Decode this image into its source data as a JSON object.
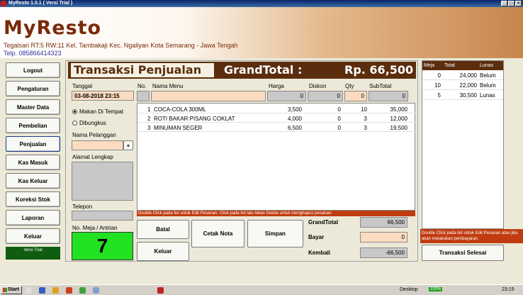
{
  "window": {
    "title": "MyResto 1.0.1 ( Versi Trial )"
  },
  "header": {
    "logo": "MyResto",
    "address": "Tegalsari RT:5 RW:11 Kel. Tambakaji Kec. Ngaliyan Kota Semarang - Jawa Tengah",
    "phone": "Telp. 085866414323"
  },
  "sidebar": {
    "items": [
      {
        "label": "Logout"
      },
      {
        "label": "Pengaturan"
      },
      {
        "label": "Master Data"
      },
      {
        "label": "Pembelian"
      },
      {
        "label": "Penjualan"
      },
      {
        "label": "Kas Masuk"
      },
      {
        "label": "Kas Keluar"
      },
      {
        "label": "Koreksi Stok"
      },
      {
        "label": "Laporan"
      },
      {
        "label": "Keluar"
      }
    ],
    "version": "Versi Trial"
  },
  "main": {
    "title": "Transaksi Penjualan",
    "grandtotal_label": "GrandTotal :",
    "grandtotal_value": "Rp. 66,500",
    "tanggal_label": "Tanggal",
    "tanggal_value": "03-08-2018 23:15",
    "radio_makan": "Makan Di Tempat",
    "radio_bungkus": "Dibungkus",
    "nama_pelanggan_label": "Nama Pelanggan",
    "plus": "+",
    "alamat_label": "Alamat Lengkap",
    "telepon_label": "Telepon",
    "meja_label": "No. Meja / Antrian",
    "meja_value": "7",
    "col_no": "No.",
    "col_nama": "Nama Menu",
    "col_harga": "Harga",
    "col_diskon": "Diskon",
    "col_qty": "Qty",
    "col_subtotal": "SubTotal",
    "input_harga": "0",
    "input_diskon": "0",
    "input_qty": "0",
    "input_subtotal": "0",
    "rows": [
      {
        "no": "1",
        "nama": "COCA-COLA 300ML",
        "harga": "3,500",
        "diskon": "0",
        "qty": "10",
        "subtotal": "35,000"
      },
      {
        "no": "2",
        "nama": "ROTI BAKAR PISANG COKLAT",
        "harga": "4,000",
        "diskon": "0",
        "qty": "3",
        "subtotal": "12,000"
      },
      {
        "no": "3",
        "nama": "MINUMAN SEGER",
        "harga": "6,500",
        "diskon": "0",
        "qty": "3",
        "subtotal": "19,500"
      }
    ],
    "note": "Double Click pada list untuk Edit Pesanan. Click pada list lalu tekan Delete untuk menghapus pesanan.",
    "btn_batal": "Batal",
    "btn_keluar": "Keluar",
    "btn_cetak": "Cetak Nota",
    "btn_simpan": "Simpan",
    "grandtotal2_label": "GrandTotal",
    "grandtotal2_value": "66,500",
    "bayar_label": "Bayar",
    "bayar_value": "0",
    "kembali_label": "Kembali",
    "kembali_value": "-66,500"
  },
  "right": {
    "cols": [
      "Meja",
      "Total",
      "Lunas"
    ],
    "rows": [
      {
        "meja": "0",
        "total": "24,000",
        "lunas": "Belum"
      },
      {
        "meja": "10",
        "total": "22,000",
        "lunas": "Belum"
      },
      {
        "meja": "5",
        "total": "30,500",
        "lunas": "Lunas"
      }
    ],
    "note": "Double Click pada list untuk Edit Pesanan atau jika akan melakukan pembayaran.",
    "btn_selesai": "Transaksi Selesai"
  },
  "taskbar": {
    "start": "Start",
    "desktop": "Desktop",
    "battery": "100%",
    "time": "23:15"
  },
  "colors": {
    "brown": "#5b2d0d",
    "accent_red": "#c03c10",
    "field_peach": "#fbdcc0",
    "meja_green": "#22e022"
  }
}
